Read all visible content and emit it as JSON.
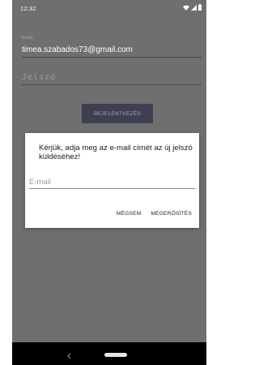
{
  "status_bar": {
    "time": "12:32",
    "icons": [
      "wifi-icon",
      "signal-icon",
      "battery-icon"
    ]
  },
  "login_form": {
    "email_label": "Email",
    "email_value": "timea.szabados73@gmail.com",
    "password_placeholder": "Jelszó",
    "login_button_label": "BEJELENTKEZÉS"
  },
  "dialog": {
    "message": "Kérjük, adja meg az e-mail címét az új jelszó küldéséhez!",
    "email_placeholder": "E-mail",
    "cancel_label": "MÉGSEM",
    "confirm_label": "MEGERŐSÍTÉS"
  },
  "nav_bar": {
    "icons": [
      "back-icon",
      "home-pill-icon"
    ]
  },
  "colors": {
    "scrim_background": "#6f6f6f",
    "login_button": "#3f3f52",
    "dialog_background": "#ffffff",
    "nav_bar": "#000000"
  }
}
